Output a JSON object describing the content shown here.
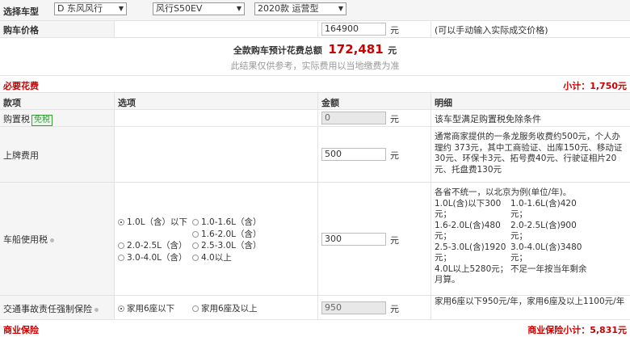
{
  "header": {
    "select_label": "选择车型",
    "brand": "D 东风风行",
    "series": "风行S50EV",
    "model": "2020款 运营型"
  },
  "price_row": {
    "label": "购车价格",
    "value": "164900",
    "unit": "元",
    "note": "(可以手动输入实际成交价格)"
  },
  "total": {
    "label": "全款购车预计花费总额",
    "value": "172,481",
    "unit": "元",
    "note": "此结果仅供参考，实际费用以当地缴费为准"
  },
  "required": {
    "title": "必要花费",
    "subtotal_label": "小计：",
    "subtotal_value": "1,750元"
  },
  "columns": {
    "item": "款项",
    "option": "选项",
    "amount": "金额",
    "detail": "明细"
  },
  "purchase_tax": {
    "label": "购置税",
    "badge": "免税",
    "value": "0",
    "unit": "元",
    "detail": "该车型满足购置税免除条件"
  },
  "plate_fee": {
    "label": "上牌费用",
    "value": "500",
    "unit": "元",
    "detail": "通常商家提供的一条龙服务收费约500元，个人办理约 373元，其中工商验证、出库150元、移动证30元、环保卡3元、拓号费40元、行驶证相片20元、托盘费130元"
  },
  "vehicle_tax": {
    "label": "车船使用税",
    "value": "300",
    "unit": "元",
    "options": [
      "1.0L（含）以下",
      "1.0-1.6L（含）",
      "1.6-2.0L（含）",
      "2.0-2.5L（含）",
      "2.5-3.0L（含）",
      "3.0-4.0L（含）",
      "4.0以上"
    ],
    "detail_lines": [
      "各省不统一，以北京为例(单位/年)。",
      "1.0L(含)以下300",
      "1.0-1.6L(含)420",
      "元；",
      "元；",
      "1.6-2.0L(含)480",
      "2.0-2.5L(含)900",
      "元；",
      "元；",
      "2.5-3.0L(含)1920",
      "3.0-4.0L(含)3480",
      "元；",
      "元；",
      "4.0L以上5280元；",
      "不足一年按当年剩余",
      "月算。"
    ]
  },
  "insurance": {
    "label": "交通事故责任强制保险",
    "option1": "家用6座以下",
    "option2": "家用6座及以上",
    "value": "950",
    "unit": "元",
    "detail": "家用6座以下950元/年，家用6座及以上1100元/年"
  },
  "commercial": {
    "title": "商业保险",
    "subtotal_label": "商业保险小计：",
    "subtotal_value": "5,831元"
  }
}
